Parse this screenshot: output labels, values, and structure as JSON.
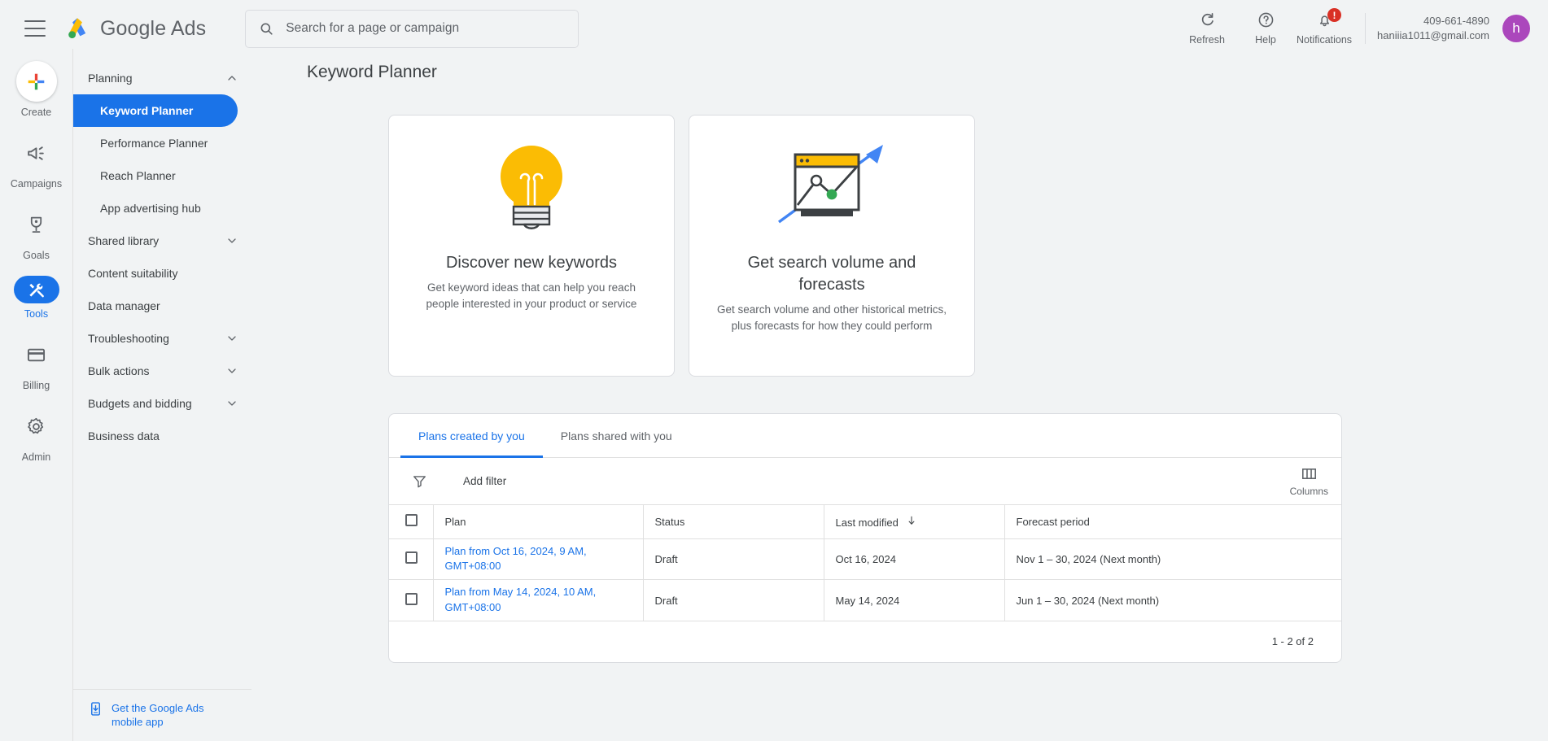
{
  "topbar": {
    "menu_icon": "hamburger-icon",
    "brand": "Google Ads",
    "search_placeholder": "Search for a page or campaign",
    "search_value": "",
    "refresh_label": "Refresh",
    "help_label": "Help",
    "notifications_label": "Notifications",
    "notification_badge": "!",
    "account_id": "409-661-4890",
    "account_email": "haniiia1011@gmail.com",
    "avatar_initial": "h"
  },
  "rail": {
    "items": [
      {
        "label": "Create",
        "icon": "plus-icon",
        "active": false
      },
      {
        "label": "Campaigns",
        "icon": "megaphone-icon",
        "active": false
      },
      {
        "label": "Goals",
        "icon": "trophy-icon",
        "active": false
      },
      {
        "label": "Tools",
        "icon": "tools-icon",
        "active": true
      },
      {
        "label": "Billing",
        "icon": "credit-card-icon",
        "active": false
      },
      {
        "label": "Admin",
        "icon": "gear-icon",
        "active": false
      }
    ]
  },
  "sidebar": {
    "items": [
      {
        "label": "Planning",
        "type": "group",
        "expanded": true
      },
      {
        "label": "Keyword Planner",
        "type": "sub",
        "selected": true
      },
      {
        "label": "Performance Planner",
        "type": "sub",
        "selected": false
      },
      {
        "label": "Reach Planner",
        "type": "sub",
        "selected": false
      },
      {
        "label": "App advertising hub",
        "type": "sub",
        "selected": false
      },
      {
        "label": "Shared library",
        "type": "group",
        "expanded": false
      },
      {
        "label": "Content suitability",
        "type": "item"
      },
      {
        "label": "Data manager",
        "type": "item"
      },
      {
        "label": "Troubleshooting",
        "type": "group",
        "expanded": false
      },
      {
        "label": "Bulk actions",
        "type": "group",
        "expanded": false
      },
      {
        "label": "Budgets and bidding",
        "type": "group",
        "expanded": false
      },
      {
        "label": "Business data",
        "type": "item"
      }
    ],
    "mobile_app_link": "Get the Google Ads mobile app"
  },
  "main": {
    "page_title": "Keyword Planner",
    "cards": [
      {
        "icon": "lightbulb-icon",
        "title": "Discover new keywords",
        "desc": "Get keyword ideas that can help you reach people interested in your product or service"
      },
      {
        "icon": "forecast-chart-icon",
        "title": "Get search volume and forecasts",
        "desc": "Get search volume and other historical metrics, plus forecasts for how they could perform"
      }
    ]
  },
  "plans_table": {
    "tabs": [
      {
        "label": "Plans created by you",
        "active": true
      },
      {
        "label": "Plans shared with you",
        "active": false
      }
    ],
    "filter_label": "Add filter",
    "columns_label": "Columns",
    "headers": [
      "Plan",
      "Status",
      "Last modified",
      "Forecast period"
    ],
    "sorted_column": "Last modified",
    "sort_direction": "desc",
    "rows": [
      {
        "plan": "Plan from Oct 16, 2024, 9 AM, GMT+08:00",
        "status": "Draft",
        "last_modified": "Oct 16, 2024",
        "forecast_period": "Nov 1 – 30, 2024 (Next month)"
      },
      {
        "plan": "Plan from May 14, 2024, 10 AM, GMT+08:00",
        "status": "Draft",
        "last_modified": "May 14, 2024",
        "forecast_period": "Jun 1 – 30, 2024 (Next month)"
      }
    ],
    "pagination": "1 - 2 of 2"
  },
  "colors": {
    "accent": "#1a73e8",
    "bg": "#f1f3f4",
    "yellow": "#fbbc04",
    "green": "#34a853",
    "red": "#d93025",
    "avatar": "#ab47bc"
  }
}
